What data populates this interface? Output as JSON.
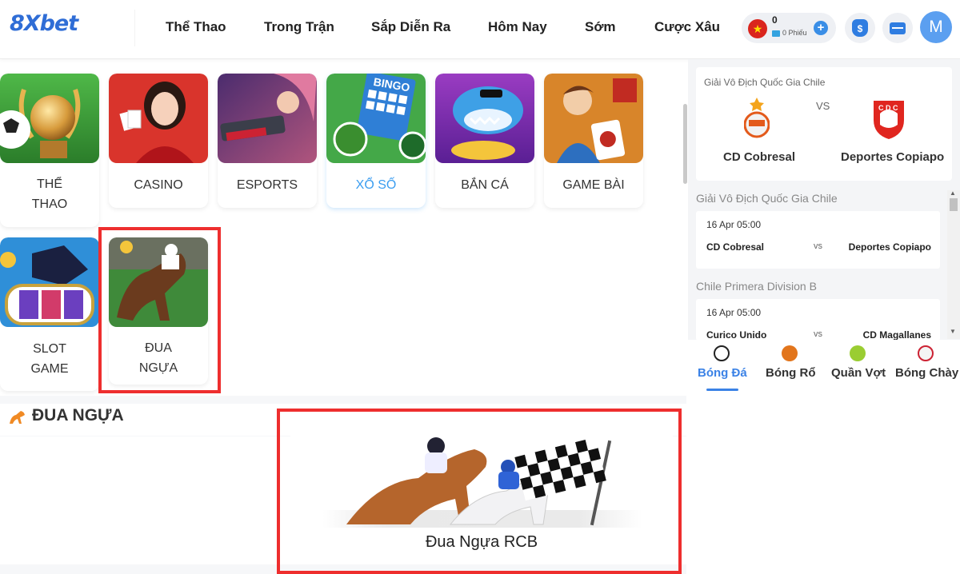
{
  "header": {
    "logo_part1": "8X",
    "logo_part2": "bet",
    "nav": [
      "Thể Thao",
      "Trong Trận",
      "Sắp Diễn Ra",
      "Hôm Nay",
      "Sớm",
      "Cược Xâu"
    ],
    "wallet_amount": "0",
    "ticket_label": "0 Phiếu",
    "avatar_letter": "M"
  },
  "games": {
    "tiles": [
      {
        "label": "THỂ THAO",
        "lines": [
          "THỂ",
          "THAO"
        ],
        "icon": "sports-trophy-icon"
      },
      {
        "label": "CASINO",
        "lines": [
          "CASINO"
        ],
        "icon": "casino-dealer-icon"
      },
      {
        "label": "ESPORTS",
        "lines": [
          "ESPORTS"
        ],
        "icon": "esports-hero-icon"
      },
      {
        "label": "XỔ SỐ",
        "lines": [
          "XỔ SỐ"
        ],
        "icon": "lottery-bingo-icon",
        "active": true
      },
      {
        "label": "BẮN CÁ",
        "lines": [
          "BẮN CÁ"
        ],
        "icon": "fishing-shark-icon"
      },
      {
        "label": "GAME BÀI",
        "lines": [
          "GAME BÀI"
        ],
        "icon": "card-game-icon"
      },
      {
        "label": "SLOT GAME",
        "lines": [
          "SLOT",
          "GAME"
        ],
        "icon": "slot-anubis-icon"
      },
      {
        "label": "ĐUA NGỰA",
        "lines": [
          "ĐUA",
          "NGỰA"
        ],
        "icon": "horse-racing-icon"
      }
    ]
  },
  "section": {
    "title": "ĐUA NGỰA",
    "provider_label": "Đua Ngựa RCB"
  },
  "sidebar": {
    "featured": {
      "league": "Giải Vô Địch Quốc Gia Chile",
      "vs": "VS",
      "home": "CD Cobresal",
      "away": "Deportes Copiapo"
    },
    "groups": [
      {
        "league": "Giải Vô Địch Quốc Gia Chile",
        "date": "16 Apr  05:00",
        "home": "CD Cobresal",
        "vs": "vs",
        "away": "Deportes Copiapo"
      },
      {
        "league": "Chile Primera Division B",
        "date": "16 Apr  05:00",
        "home": "Curico Unido",
        "vs": "vs",
        "away": "CD Magallanes"
      }
    ],
    "sports": [
      "Bóng Đá",
      "Bóng Rổ",
      "Quần Vợt",
      "Bóng Chày"
    ]
  },
  "colors": {
    "accent": "#3b82e6",
    "highlight": "#ee2e2e",
    "active_tab": "#3a9df0"
  }
}
